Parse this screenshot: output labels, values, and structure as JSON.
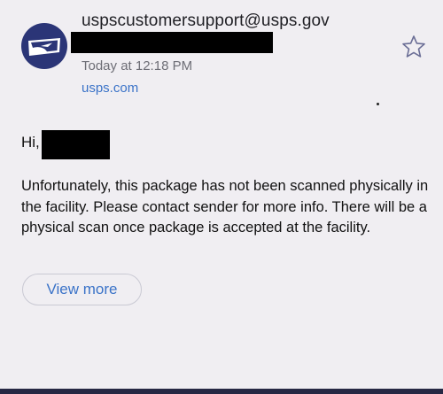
{
  "email": {
    "sender": "uspscustomersupport@usps.gov",
    "timestamp": "Today at 12:18 PM",
    "domain_link": "usps.com",
    "greeting": "Hi,",
    "body": "Unfortunately, this package has not been scanned physically in the facility. Please contact sender for more info. There will be a physical scan once package is accepted at the facility.",
    "view_more_label": "View more"
  },
  "icons": {
    "avatar": "usps-eagle-logo-icon",
    "star": "star-outline-icon"
  },
  "colors": {
    "background": "#f0eef2",
    "avatar_background": "#2b3577",
    "link": "#3b73c8",
    "redaction": "#000000",
    "bottom_bar": "#262844"
  }
}
